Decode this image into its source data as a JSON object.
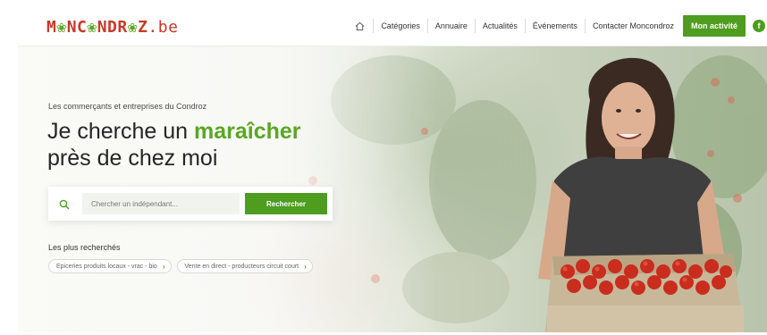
{
  "header": {
    "logo_main": "M",
    "logo_dot1": "❀",
    "logo_mid": "NC",
    "logo_dot2": "❀",
    "logo_end": "NDR",
    "logo_dot3": "❀",
    "logo_tail": "Z",
    "logo_tld": ".be",
    "nav": {
      "categories": "Catégories",
      "annuaire": "Annuaire",
      "actualites": "Actualités",
      "evenements": "Événements",
      "contact": "Contacter Moncondroz",
      "cta": "Mon activité"
    },
    "icons": {
      "home": "home-icon",
      "social": "facebook-icon"
    }
  },
  "hero": {
    "eyebrow": "Les commerçants et entreprises du Condroz",
    "headline_pre": "Je cherche un ",
    "headline_accent": "maraîcher",
    "headline_post": "près de chez moi",
    "search": {
      "placeholder": "Chercher un indépendant...",
      "button": "Rechercher",
      "icon": "search-icon"
    },
    "popular_label": "Les plus recherchés",
    "chips": [
      "Epiceries produits locaux - vrac - bio",
      "Vente en direct - producteurs circuit court"
    ]
  },
  "colors": {
    "accent": "#4e9d1f",
    "accent_text": "#5aa624",
    "logo_red": "#c63a2a",
    "text": "#262626"
  }
}
